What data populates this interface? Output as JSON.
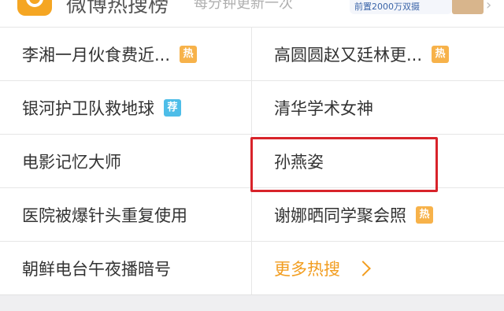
{
  "header": {
    "title": "微博热搜榜",
    "subtitle": "每分钟更新一次",
    "ad_text": "前置2000万双摄",
    "icons": [
      "weibo-logo-icon",
      "chevron-right-icon"
    ]
  },
  "grid": {
    "rows": [
      {
        "left": {
          "label": "李湘一月伙食费近...",
          "badge": "热",
          "badge_type": "hot"
        },
        "right": {
          "label": "高圆圆赵又廷林更...",
          "badge": "热",
          "badge_type": "hot"
        }
      },
      {
        "left": {
          "label": "银河护卫队救地球",
          "badge": "荐",
          "badge_type": "recommended"
        },
        "right": {
          "label": "清华学术女神"
        }
      },
      {
        "left": {
          "label": "电影记忆大师"
        },
        "right": {
          "label": "孙燕姿",
          "highlighted": true
        }
      },
      {
        "left": {
          "label": "医院被爆针头重复使用"
        },
        "right": {
          "label": "谢娜晒同学聚会照",
          "badge": "热",
          "badge_type": "hot"
        }
      },
      {
        "left": {
          "label": "朝鲜电台午夜播暗号"
        },
        "right": {
          "label": "更多热搜",
          "is_more_link": true
        }
      }
    ]
  },
  "colors": {
    "hot_badge": "#f7b24a",
    "recommended_badge": "#4dbde8",
    "more_link": "#f29d1f",
    "highlight_box": "#d8232a"
  }
}
